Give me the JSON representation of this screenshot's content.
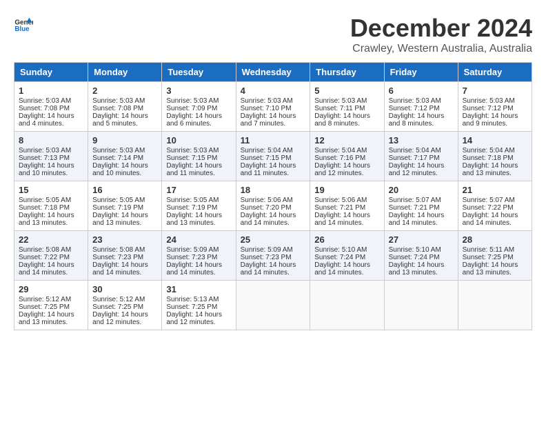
{
  "logo": {
    "line1": "General",
    "line2": "Blue"
  },
  "title": "December 2024",
  "location": "Crawley, Western Australia, Australia",
  "days_of_week": [
    "Sunday",
    "Monday",
    "Tuesday",
    "Wednesday",
    "Thursday",
    "Friday",
    "Saturday"
  ],
  "weeks": [
    [
      {
        "day": "1",
        "sunrise": "5:03 AM",
        "sunset": "7:08 PM",
        "daylight": "14 hours and 4 minutes."
      },
      {
        "day": "2",
        "sunrise": "5:03 AM",
        "sunset": "7:08 PM",
        "daylight": "14 hours and 5 minutes."
      },
      {
        "day": "3",
        "sunrise": "5:03 AM",
        "sunset": "7:09 PM",
        "daylight": "14 hours and 6 minutes."
      },
      {
        "day": "4",
        "sunrise": "5:03 AM",
        "sunset": "7:10 PM",
        "daylight": "14 hours and 7 minutes."
      },
      {
        "day": "5",
        "sunrise": "5:03 AM",
        "sunset": "7:11 PM",
        "daylight": "14 hours and 8 minutes."
      },
      {
        "day": "6",
        "sunrise": "5:03 AM",
        "sunset": "7:12 PM",
        "daylight": "14 hours and 8 minutes."
      },
      {
        "day": "7",
        "sunrise": "5:03 AM",
        "sunset": "7:12 PM",
        "daylight": "14 hours and 9 minutes."
      }
    ],
    [
      {
        "day": "8",
        "sunrise": "5:03 AM",
        "sunset": "7:13 PM",
        "daylight": "14 hours and 10 minutes."
      },
      {
        "day": "9",
        "sunrise": "5:03 AM",
        "sunset": "7:14 PM",
        "daylight": "14 hours and 10 minutes."
      },
      {
        "day": "10",
        "sunrise": "5:03 AM",
        "sunset": "7:15 PM",
        "daylight": "14 hours and 11 minutes."
      },
      {
        "day": "11",
        "sunrise": "5:04 AM",
        "sunset": "7:15 PM",
        "daylight": "14 hours and 11 minutes."
      },
      {
        "day": "12",
        "sunrise": "5:04 AM",
        "sunset": "7:16 PM",
        "daylight": "14 hours and 12 minutes."
      },
      {
        "day": "13",
        "sunrise": "5:04 AM",
        "sunset": "7:17 PM",
        "daylight": "14 hours and 12 minutes."
      },
      {
        "day": "14",
        "sunrise": "5:04 AM",
        "sunset": "7:18 PM",
        "daylight": "14 hours and 13 minutes."
      }
    ],
    [
      {
        "day": "15",
        "sunrise": "5:05 AM",
        "sunset": "7:18 PM",
        "daylight": "14 hours and 13 minutes."
      },
      {
        "day": "16",
        "sunrise": "5:05 AM",
        "sunset": "7:19 PM",
        "daylight": "14 hours and 13 minutes."
      },
      {
        "day": "17",
        "sunrise": "5:05 AM",
        "sunset": "7:19 PM",
        "daylight": "14 hours and 13 minutes."
      },
      {
        "day": "18",
        "sunrise": "5:06 AM",
        "sunset": "7:20 PM",
        "daylight": "14 hours and 14 minutes."
      },
      {
        "day": "19",
        "sunrise": "5:06 AM",
        "sunset": "7:21 PM",
        "daylight": "14 hours and 14 minutes."
      },
      {
        "day": "20",
        "sunrise": "5:07 AM",
        "sunset": "7:21 PM",
        "daylight": "14 hours and 14 minutes."
      },
      {
        "day": "21",
        "sunrise": "5:07 AM",
        "sunset": "7:22 PM",
        "daylight": "14 hours and 14 minutes."
      }
    ],
    [
      {
        "day": "22",
        "sunrise": "5:08 AM",
        "sunset": "7:22 PM",
        "daylight": "14 hours and 14 minutes."
      },
      {
        "day": "23",
        "sunrise": "5:08 AM",
        "sunset": "7:23 PM",
        "daylight": "14 hours and 14 minutes."
      },
      {
        "day": "24",
        "sunrise": "5:09 AM",
        "sunset": "7:23 PM",
        "daylight": "14 hours and 14 minutes."
      },
      {
        "day": "25",
        "sunrise": "5:09 AM",
        "sunset": "7:23 PM",
        "daylight": "14 hours and 14 minutes."
      },
      {
        "day": "26",
        "sunrise": "5:10 AM",
        "sunset": "7:24 PM",
        "daylight": "14 hours and 14 minutes."
      },
      {
        "day": "27",
        "sunrise": "5:10 AM",
        "sunset": "7:24 PM",
        "daylight": "14 hours and 13 minutes."
      },
      {
        "day": "28",
        "sunrise": "5:11 AM",
        "sunset": "7:25 PM",
        "daylight": "14 hours and 13 minutes."
      }
    ],
    [
      {
        "day": "29",
        "sunrise": "5:12 AM",
        "sunset": "7:25 PM",
        "daylight": "14 hours and 13 minutes."
      },
      {
        "day": "30",
        "sunrise": "5:12 AM",
        "sunset": "7:25 PM",
        "daylight": "14 hours and 12 minutes."
      },
      {
        "day": "31",
        "sunrise": "5:13 AM",
        "sunset": "7:25 PM",
        "daylight": "14 hours and 12 minutes."
      },
      null,
      null,
      null,
      null
    ]
  ]
}
